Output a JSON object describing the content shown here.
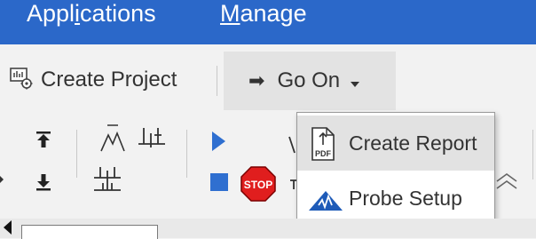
{
  "menubar": {
    "applications": {
      "pre": "Appl",
      "mn": "i",
      "post": "cations"
    },
    "manage": {
      "pre": "",
      "mn": "M",
      "post": "anage"
    }
  },
  "ribbon": {
    "create_project_label": "Create Project",
    "go_on_label": "Go On",
    "stop_label": "STOP"
  },
  "dropdown": {
    "items": [
      {
        "label": "Create Report",
        "icon": "pdf-document-icon",
        "icon_text": "PDF"
      },
      {
        "label": "Probe Setup",
        "icon": "probe-setup-icon"
      }
    ]
  },
  "colors": {
    "menubar": "#2b68c9",
    "accent_blue": "#2f6fd0",
    "stop_red": "#e01e1e"
  }
}
